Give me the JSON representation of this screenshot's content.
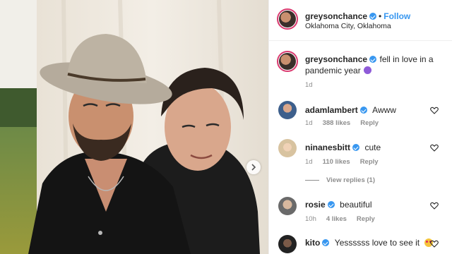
{
  "post": {
    "username": "greysonchance",
    "follow_label": "Follow",
    "separator": "•",
    "location": "Oklahoma City, Oklahoma",
    "caption": "fell in love in a pandemic year",
    "caption_emoji_icon": "purple-heart-emoji-icon",
    "age": "1d"
  },
  "comments": [
    {
      "username": "adamlambert",
      "verified": true,
      "text": "Awww",
      "age": "1d",
      "likes": "388 likes",
      "reply": "Reply"
    },
    {
      "username": "ninanesbitt",
      "verified": true,
      "text": "cute",
      "age": "1d",
      "likes": "110 likes",
      "reply": "Reply",
      "view_replies": "View replies (1)"
    },
    {
      "username": "rosie",
      "verified": true,
      "text": "beautiful",
      "age": "10h",
      "likes": "4 likes",
      "reply": "Reply"
    },
    {
      "username": "kito",
      "verified": true,
      "text": "Yessssss love to see it",
      "emoji_icon": "heart-eyes-emoji-icon"
    }
  ],
  "colors": {
    "accent": "#3897f0",
    "ring": "#d93a6f",
    "muted": "#8e8e8e"
  }
}
